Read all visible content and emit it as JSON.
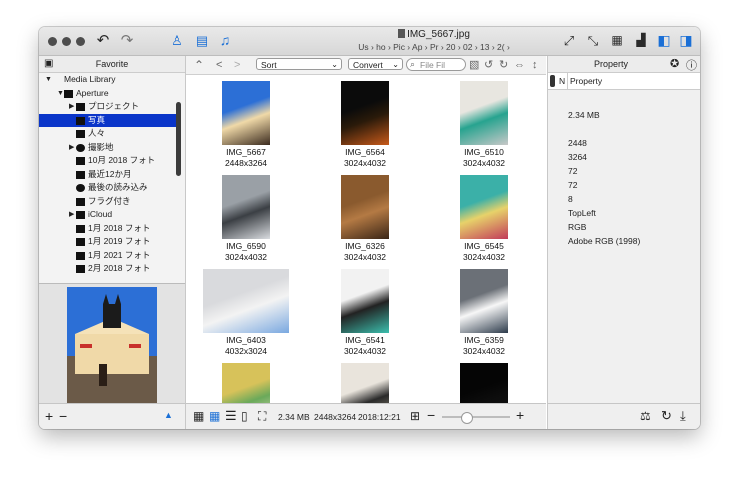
{
  "window": {
    "title": "IMG_5667.jpg",
    "breadcrumb": "Us › ho › Pic › Ap › Pr › 20 › 02 › 13 › 2( ›"
  },
  "sidebar": {
    "header": "Favorite",
    "items": [
      {
        "label": "Media Library",
        "disclosure": "▼",
        "level": 0
      },
      {
        "label": "Aperture",
        "disclosure": "▼",
        "level": 1
      },
      {
        "label": "プロジェクト",
        "disclosure": "▶",
        "level": 2
      },
      {
        "label": "写真",
        "disclosure": "",
        "level": 2,
        "selected": true
      },
      {
        "label": "人々",
        "disclosure": "",
        "level": 2
      },
      {
        "label": "撮影地",
        "disclosure": "▶",
        "level": 2
      },
      {
        "label": "10月 2018 フォト",
        "disclosure": "",
        "level": 2
      },
      {
        "label": "最近12か月",
        "disclosure": "",
        "level": 2
      },
      {
        "label": "最後の読み込み",
        "disclosure": "",
        "level": 2
      },
      {
        "label": "フラグ付き",
        "disclosure": "",
        "level": 2
      },
      {
        "label": "iCloud",
        "disclosure": "▶",
        "level": 2
      },
      {
        "label": "1月 2018 フォト",
        "disclosure": "",
        "level": 2
      },
      {
        "label": "1月 2019 フォト",
        "disclosure": "",
        "level": 2
      },
      {
        "label": "1月 2021 フォト",
        "disclosure": "",
        "level": 2
      },
      {
        "label": "2月 2018 フォト",
        "disclosure": "",
        "level": 2
      }
    ],
    "add_label": "+",
    "remove_label": "−"
  },
  "browser": {
    "sort_label": "Sort",
    "convert_label": "Convert",
    "search_placeholder": "File Fil",
    "photos": [
      {
        "name": "IMG_5667",
        "size": "2448x3264",
        "colors": [
          "#2c6fd6",
          "#f0d9a8",
          "#3a2a1e"
        ]
      },
      {
        "name": "IMG_6564",
        "size": "3024x4032",
        "colors": [
          "#0b0b0b",
          "#2a1a0a",
          "#c85a1a"
        ]
      },
      {
        "name": "IMG_6510",
        "size": "3024x4032",
        "colors": [
          "#e8e6e0",
          "#27a38f",
          "#c8c8c8"
        ]
      },
      {
        "name": "IMG_6590",
        "size": "3024x4032",
        "colors": [
          "#9aa0a6",
          "#3b3f44",
          "#d9dce0"
        ]
      },
      {
        "name": "IMG_6326",
        "size": "3024x4032",
        "colors": [
          "#8a5a2e",
          "#b47a44",
          "#3a2516"
        ]
      },
      {
        "name": "IMG_6545",
        "size": "3024x4032",
        "colors": [
          "#3bb0a8",
          "#e7d26a",
          "#c23a5a"
        ]
      },
      {
        "name": "IMG_6403",
        "size": "4032x3024",
        "colors": [
          "#d9dadd",
          "#f3f3f3",
          "#7aa8e0"
        ]
      },
      {
        "name": "IMG_6541",
        "size": "3024x4032",
        "colors": [
          "#f2f2f2",
          "#222222",
          "#3bbfae"
        ]
      },
      {
        "name": "IMG_6359",
        "size": "3024x4032",
        "colors": [
          "#6b7077",
          "#f7f7f7",
          "#2c3a4a"
        ]
      },
      {
        "name": "",
        "size": "",
        "colors": [
          "#d7c25a",
          "#6aa95a",
          "#f0e8c8"
        ]
      },
      {
        "name": "",
        "size": "",
        "colors": [
          "#e9e4dc",
          "#2a2a2a",
          "#b0a890"
        ]
      },
      {
        "name": "",
        "size": "",
        "colors": [
          "#050505",
          "#0d0d0d",
          "#111111"
        ]
      }
    ]
  },
  "statusbar": {
    "file_size": "2.34 MB",
    "dimensions": "2448x3264",
    "date": "2018:12:21",
    "zoom_minus": "−",
    "zoom_plus": "+",
    "zoom_level": 0.35
  },
  "inspector": {
    "header": "Property",
    "col_n": "N",
    "col_property": "Property",
    "values": [
      "2.34 MB",
      "",
      "2448",
      "3264",
      "72",
      "72",
      "8",
      "TopLeft",
      "RGB",
      "Adobe RGB (1998)"
    ]
  },
  "colors": {
    "selection": "#0a35c9",
    "accent": "#1a6fd6"
  }
}
